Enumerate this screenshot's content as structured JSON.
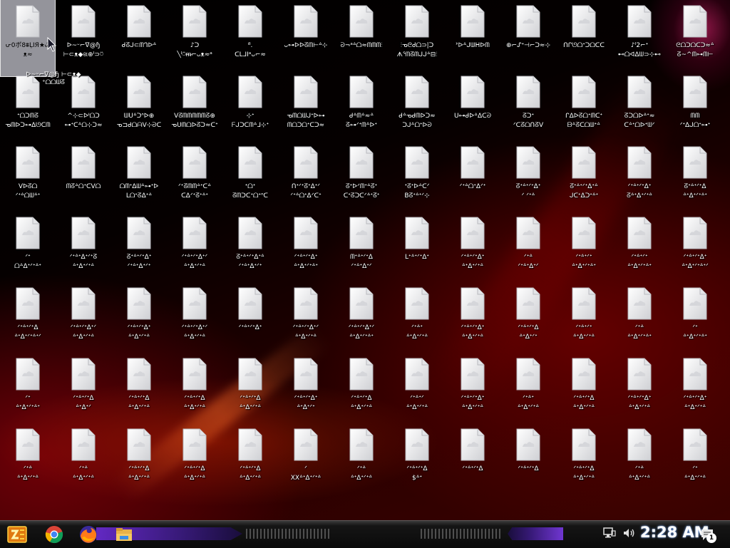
{
  "desktop": {
    "icons": [
      {
        "l1": "ᕂ0ボ8⩩ḶIЯ★Ꮚ",
        "l2": "ᴥ≈"
      },
      {
        "l1": "ᐅ~ᵕ⌐ᐁ@ɧ",
        "l2": "⊢⊂ᴥ◆ଖ⊕ᴵ⊃⍥"
      },
      {
        "l1": "ᑯᘔᒍ⊂ᗰᒉᐅᐞ",
        "l2": ""
      },
      {
        "l1": "♪ᑐ",
        "l2": "╲ᴵ⍥ᵯ⌐ᴗᴥ≈ᵃ"
      },
      {
        "l1": "ᴽ.",
        "l2": "ᑕLᒧIᵃᴗ⌐≈"
      },
      {
        "l1": "ᴗ⊶ᐅᐅᘔᗰ⊢ᐞ⊹",
        "l2": ""
      },
      {
        "l1": "ᘐ¬ᵃᐞᗝ≈ᗰᗰᗰ⫶",
        "l2": ""
      },
      {
        "l1": "⫶ᓀᘓᑯᗝ⊃|ᑐ",
        "l2": "ᗑᕐᗰᘔᗰᒍᒍᐞ⊟⫶"
      },
      {
        "l1": "ᕑᐅᐞᒍᗯᕼᐅᗰ",
        "l2": ""
      },
      {
        "l1": "⊕⌐ᔑᐩ⊣⌐ᑐ≈⊹",
        "l2": ""
      },
      {
        "l1": "ᑎᒋᘎᗝᐩᑐᗝᑕᑕ",
        "l2": ""
      },
      {
        "l1": "♪ᴵ2⌐ᐩ",
        "l2": "⊷ᗝᐊᐃᗯ⊃⊹⊷"
      },
      {
        "l1": "ᘓᗝᑐᗝᑕᑐ≈ᐞ",
        "l2": "ᘔ~^ᗰ⊶ᗰ⊢"
      },
      {
        "l1": "ᐩᗝᑐᗰᘔ",
        "l2": "ᓀᗰᐅᑐ⊶ᐃᘎᑕᗰ"
      },
      {
        "l1": "^⊹⊂ᐅᑊᗝᑐ",
        "l2": "⊶ᐩᑕᐞᗝ⊹ᑐ≈"
      },
      {
        "l1": "ᗯᑌᐞᑐᐢᐅ⊕",
        "l2": "ᓀ⊐ᑯᗝᗩᐯ⊹ᘐᑕ"
      },
      {
        "l1": "ᐯᘔᗰᗰᗰᗰᗰᘔ⊕",
        "l2": "ᓀᑌᗰᗝᐅᘔᑐ≈ᑕᐩ"
      },
      {
        "l1": "⊹ᐩ",
        "l2": "ᖴᒍᑐᑕᗰᐞᒧ⊹ᐩ"
      },
      {
        "l1": "ᓀᗰᗝᗯᒍᐩᐅ⊶",
        "l2": "ᗰᗝᑐᗝᐩᑕᑐ≈"
      },
      {
        "l1": "ᑯᐞᗰᐞ≈ᐞ",
        "l2": "ᘔ⊶ᐟᐩᗰᐞᐅᐩ"
      },
      {
        "l1": "ᑯᐞᓀᑯᗰᐅᑐ≈",
        "l2": "ᑐᒍᐞᗝᐩᐅᘐ"
      },
      {
        "l1": "ᑌ⊶ᑯᐅᐞᐃᑕᘐ",
        "l2": ""
      },
      {
        "l1": "ᘔᑐᐩ",
        "l2": "ᐟᑕᘔᗝᑎᘔᐯ"
      },
      {
        "l1": "ᒋᐃᐅᘔᗝᐩᗰᑕᐩ",
        "l2": "ᗷᐞᘔᑕᗝᗯᐩᐞ"
      },
      {
        "l1": "ᘔᑐᗝᐅᐞᐩ≈",
        "l2": "ᑕᐞᐩᗝᐅᐩᗯᐟ"
      },
      {
        "l1": "ᗰᗰ",
        "l2": "ᐟᐩᐃᒍᗝᐩ⊶ᐩ"
      },
      {
        "l1": "ᐯᐅᘔᗝ",
        "l2": "ᐟᐩᐞᗝᗯᐞᐩ"
      },
      {
        "l1": "ᗰᘔᐞᗝᐩᑕᐯᗝ",
        "l2": ""
      },
      {
        "l1": "ᗝᗰᐩᐃᗯᐞ⊶ᐩᐅ",
        "l2": "ᒪᗝᐩᘔᐃᐩᐞ"
      },
      {
        "l1": "ᐟᐩᘔᗰᗰᐞᐩᑕᐞ",
        "l2": "ᑕᐃᐟᐩᘔᐩᐞᐩ"
      },
      {
        "l1": "ᐩᗝᐩ",
        "l2": "ᘔᗰᑐᑕᐩᗝᐩᐢᑕ"
      },
      {
        "l1": "ᑎᐩᐟᐩᘔᐩᐃᐩᐟ",
        "l2": "ᐟᐩᐞᗝᐩᐃᐟᑕᐩ"
      },
      {
        "l1": "ᘔᐩᐅᐟᗰᐩᐞᘔᐩ",
        "l2": "ᑕᐩᘔᑐᑕᐟᐞᐩᘔᐩ"
      },
      {
        "l1": "ᐩᘔᐩᐅᐞᑕᐟ",
        "l2": "Bᘔᐩᐞᐩᐟ⊹"
      },
      {
        "l1": "ᐟᐩᐞᗝᐩᐃᐟᐩ",
        "l2": ""
      },
      {
        "l1": "ᘔᐩᐞᐩᐟᐩᐃᐩ",
        "l2": "ᐟ ᐟᐩᐞ"
      },
      {
        "l1": "ᘔᐩᐞᐩᐟᐩᐃᐩᐞ",
        "l2": "ᒍᑕᐩᐃᑐᐩᐞᐩ"
      },
      {
        "l1": "ᐟᐩᐞᐩᐟᐩᐃᐩ",
        "l2": "ᘔᐞᐩᐃᐩᐟᐩᐞ"
      },
      {
        "l1": "ᘔᐩᐞᐩᐟᐩᐃ",
        "l2": "ᐞᐩᐃᐩᐟᐩᐞᐩ"
      },
      {
        "l1": "ᐟᐩ",
        "l2": "ᗝᐞᐃᐩᐟᐩᐞᐩ"
      },
      {
        "l1": "ᐟᐩᐞᐩᐃᐩᐟᐩᘔ",
        "l2": "ᐞᐩᐃᐩᐟᐩᐞ"
      },
      {
        "l1": "ᘔᐩᐞᐩᐟᐩᐃᐩ",
        "l2": "ᐟᐩᐞᐩᐃᐩᐟᐩ"
      },
      {
        "l1": "ᐟᐩᐞᐩᐟᐩᐃᐩᐟ",
        "l2": "ᐞᐩᐃᐩᐟᐩᐞ"
      },
      {
        "l1": "ᘔᐩᐞᐩᐟᐩᐃᐩᐞ",
        "l2": "ᐟᐩᐞᐩᐃᐩᐟᐩ"
      },
      {
        "l1": "ᐟᐩᐞᐩᐟᐩᐃᐩ",
        "l2": "ᐞᐩᐃᐩᐟᐩᐞᐩ"
      },
      {
        "l1": "ᗰᐩᐞᐩᐟᐩᐃ",
        "l2": "ᐟᐩᐞᐩᐃᐩᐟ"
      },
      {
        "l1": "ᒪᐩᐞᐩᐟᐩᐃᐩ",
        "l2": ""
      },
      {
        "l1": "ᐟᐩᐞᐩᐟᐩᐃᐩ",
        "l2": "ᐞᐩᐃᐩᐟᐩᐞ"
      },
      {
        "l1": "ᐟᐩᐞ",
        "l2": "ᐟᐩᐞᐩᐃᐩᐟ"
      },
      {
        "l1": "ᐟᐩᐞᐩᐟᐩ",
        "l2": "ᐞᐩᐃᐩᐟᐩᐞᐩ"
      },
      {
        "l1": "ᐟᐩᐞᐩᐟᐩ",
        "l2": "ᐞᐩᐃᐩᐟᐩᐞᐩ"
      },
      {
        "l1": "ᐟᐩᐞᐩᐟᐩᐃᐩ",
        "l2": "ᐞᐩᐃᐩᐟᐩᐞᐩᐟ"
      },
      {
        "l1": "ᐟᐩᐞᐩᐟᐩᐃ",
        "l2": "ᐞᐩᐃᐩᐟᐩᐞᐩᐟ"
      },
      {
        "l1": "ᐟᐩᐞᐩᐟᐩᐃᐩᐟ",
        "l2": "ᐞᐩᐃᐩᐟᐩᐞ"
      },
      {
        "l1": "ᐟᐩᐞᐩᐟᐩᐃᐩ",
        "l2": "ᐞᐩᐃᐩᐟᐩᐞ"
      },
      {
        "l1": "ᐟᐩᐞᐩᐟᐩᐃᐩᐟ",
        "l2": "ᐞᐩᐃᐩᐟᐩᐞ"
      },
      {
        "l1": "ᐟᐩᐞᐩᐟᐩᐃᐩ",
        "l2": ""
      },
      {
        "l1": "ᐟᐩᐞᐩᐟᐩᐃᐩᐟ",
        "l2": "ᐞᐩᐃᐩᐟᐩᐞ"
      },
      {
        "l1": "ᐟᐩᐞᐩᐟᐩᐃᐩᐟ",
        "l2": "ᐞᐩᐃᐩᐟᐩᐞᐩ"
      },
      {
        "l1": "ᐟᐩᐞᐩ",
        "l2": "ᐞᐩᐃᐩᐟᐩᐞ"
      },
      {
        "l1": "ᐟᐩᐞᐩᐟᐩᐃᐩ",
        "l2": "ᐞᐩᐃᐩᐟᐩᐞ"
      },
      {
        "l1": "ᐟᐩᐞᐩᐟᐩᐃ",
        "l2": "ᐞᐩᐃᐩᐟᐩ"
      },
      {
        "l1": "ᐟᐩᐞᐩᐟᐩ",
        "l2": "ᐞᐩᐃᐩᐟᐩᐞ"
      },
      {
        "l1": "ᐟᐩᐞ",
        "l2": "ᐞᐩᐃᐩᐟᐩᐞᐩ"
      },
      {
        "l1": "ᐟᐩ",
        "l2": "ᐞᐩᐃᐩᐟᐩᐞᐩ"
      },
      {
        "l1": "ᐟᐩ",
        "l2": "ᐞᐩᐃᐩᐟᐩᐞᐩ"
      },
      {
        "l1": "ᐟᐩᐞᐩᐟᐩᐃ",
        "l2": "ᐞᐩᐃᐩᐟ"
      },
      {
        "l1": "ᐟᐩᐞᐩᐟᐩᐃ",
        "l2": "ᐞᐩᐃᐩᐟᐩᐞ"
      },
      {
        "l1": "ᐟᐩᐞᐩᐟᐩᐃ",
        "l2": "ᐞᐩᐃᐩᐟᐩᐞ"
      },
      {
        "l1": "ᐟᐩᐞᐩᐟᐩᐃ",
        "l2": "ᐞᐩᐃᐩᐟᐩᐞ"
      },
      {
        "l1": "ᐟᐩᐞᐩᐟᐩᐃᐩ",
        "l2": "ᐞᐩᐃᐩᐟᐩ"
      },
      {
        "l1": "ᐟᐩᐞᐩᐟᐩᐃ",
        "l2": "ᐞᐩᐃᐩᐟᐩᐞ"
      },
      {
        "l1": "ᐟᐩᐞᐩᐟ",
        "l2": "ᐞᐩᐃᐩᐟᐩᐞ"
      },
      {
        "l1": "ᐟᐩᐞᐩᐟᐩᐃᐩ",
        "l2": "ᐞᐩᐃᐩᐟᐩᐞ"
      },
      {
        "l1": "ᐟᐩᐞᐩ",
        "l2": "ᐞᐩᐃᐩᐟᐩᐞ"
      },
      {
        "l1": "ᐟᐩᐞᐩᐟᐩᐃ",
        "l2": "ᐞᐩᐃᐩᐟᐩᐞ"
      },
      {
        "l1": "ᐟᐩᐞᐩᐟᐩᐃᐩ",
        "l2": "ᐞᐩᐃᐩᐟᐩᐞ"
      },
      {
        "l1": "ᐟᐩᐞᐩᐟᐩᐃᐩ",
        "l2": "ᐞᐩᐃᐩᐟᐩᐞ"
      },
      {
        "l1": "ᐟᐩᐞ",
        "l2": "ᐞᐩᐃᐩᐟᐩᐞ"
      },
      {
        "l1": "ᐟᐩᐞ",
        "l2": "ᐞᐩᐃᐩᐟᐩᐞ"
      },
      {
        "l1": "ᐟᐩᐞᐩᐟᐩᐃ",
        "l2": "ᐞᐩᐃᐩᐟᐩᐞ"
      },
      {
        "l1": "ᐟᐩᐞᐩᐟᐩᐃ",
        "l2": "ᐞᐩᐃᐩᐟᐩᐞ"
      },
      {
        "l1": "ᐟᐩᐞᐩᐟᐩᐃ",
        "l2": "ᐞᐩᐃᐩᐟᐩᐞ"
      },
      {
        "l1": "ᐟ",
        "l2": "XXᐞᐩᐃᐩᐟᐩᐞ"
      },
      {
        "l1": "ᐟᐩᐞ",
        "l2": "ᐞᐩᐃᐩᐟᐩᐞ"
      },
      {
        "l1": "ᐟᐩᐞᐩᐟᐩᐃ",
        "l2": "$ᐞᐩ"
      },
      {
        "l1": "ᐟᐩᐞᐩᐟᐩᐃ",
        "l2": ""
      },
      {
        "l1": "ᐟᐩᐞᐩᐟᐩᐃ",
        "l2": ""
      },
      {
        "l1": "ᐟᐩᐞᐩᐟᐩᐃ",
        "l2": "ᐞᐩᐃᐩᐟᐩᐞ"
      },
      {
        "l1": "ᐟᐩᐞ",
        "l2": "ᐞᐩᐃᐩᐟᐩᐞ"
      },
      {
        "l1": "ᐟᐩ",
        "l2": "ᐞᐩᐃᐩᐟᐩᐞ"
      }
    ],
    "selected_overflow_text": "ᐅ~ᵕ⌐ᐁ@ɧ ⊢⊂ᴥ◆ ⁺ᗝᗝᗯᘔ"
  },
  "taskbar": {
    "clock": "2:28 AM",
    "notification_count": "1",
    "pinned": [
      "chrome-icon",
      "firefox-icon",
      "file-explorer-icon"
    ],
    "colors": {
      "accent": "#6b2bd6",
      "clock_glow": "#7fb0ff"
    }
  }
}
